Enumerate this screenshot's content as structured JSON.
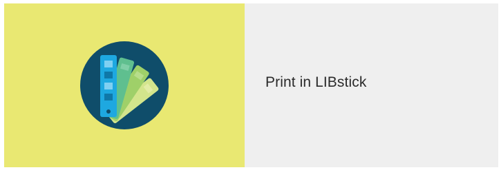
{
  "item": {
    "icon": "swatch-fan-icon",
    "title": "Print in LIBstick"
  },
  "colors": {
    "thumb_background": "#e9e872",
    "info_background": "#efefef",
    "icon_circle": "#0f4d6a",
    "swatch_blue": "#1ea8e0",
    "swatch_green": "#5fbf8f",
    "swatch_lime": "#9fd069",
    "swatch_pale": "#d3e58c",
    "label_text": "#2a2a2a"
  }
}
